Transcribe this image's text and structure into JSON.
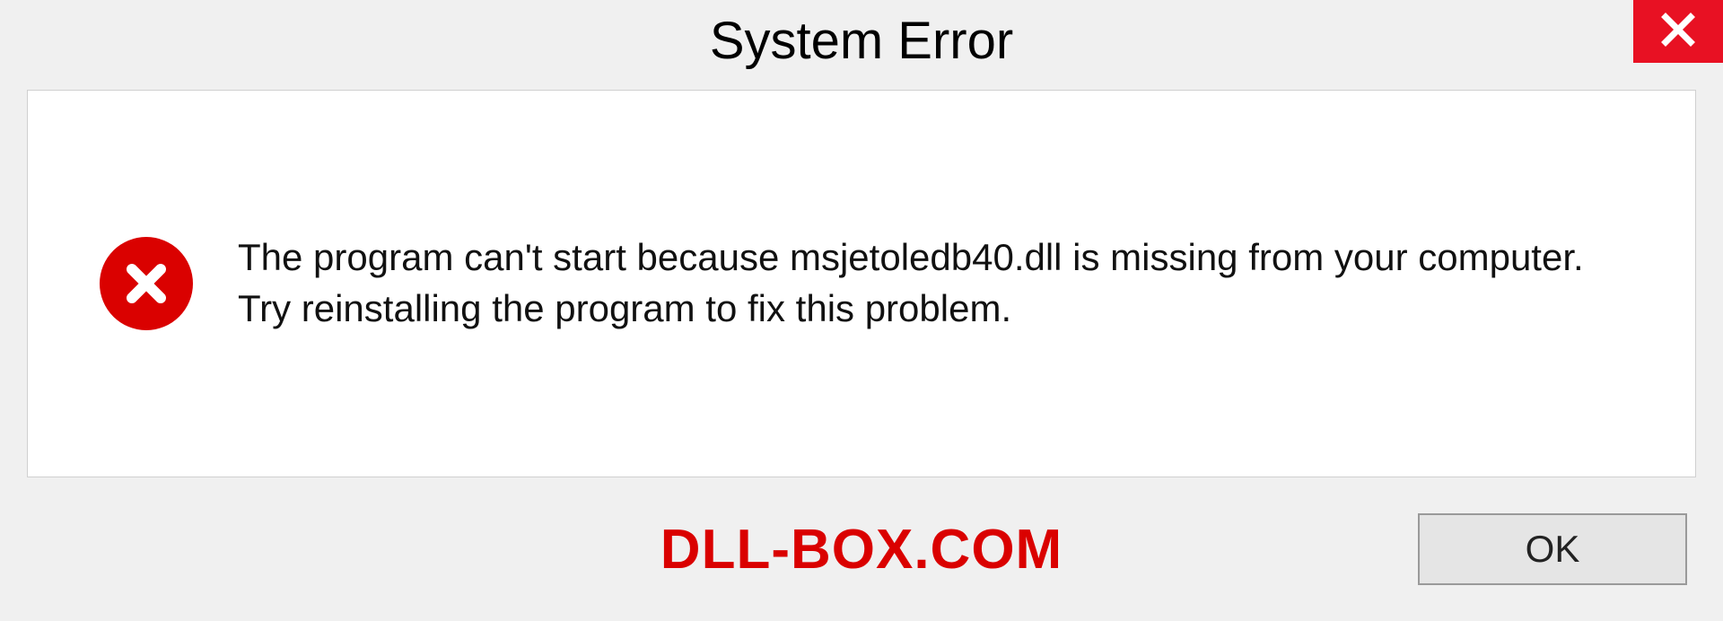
{
  "dialog": {
    "title": "System Error",
    "message": "The program can't start because msjetoledb40.dll is missing from your computer. Try reinstalling the program to fix this problem.",
    "ok_label": "OK"
  },
  "watermark": "DLL-BOX.COM",
  "icons": {
    "close": "close-icon",
    "error": "error-circle-x-icon"
  },
  "colors": {
    "close_bg": "#e81123",
    "error_bg": "#da0100",
    "watermark": "#da0100"
  }
}
